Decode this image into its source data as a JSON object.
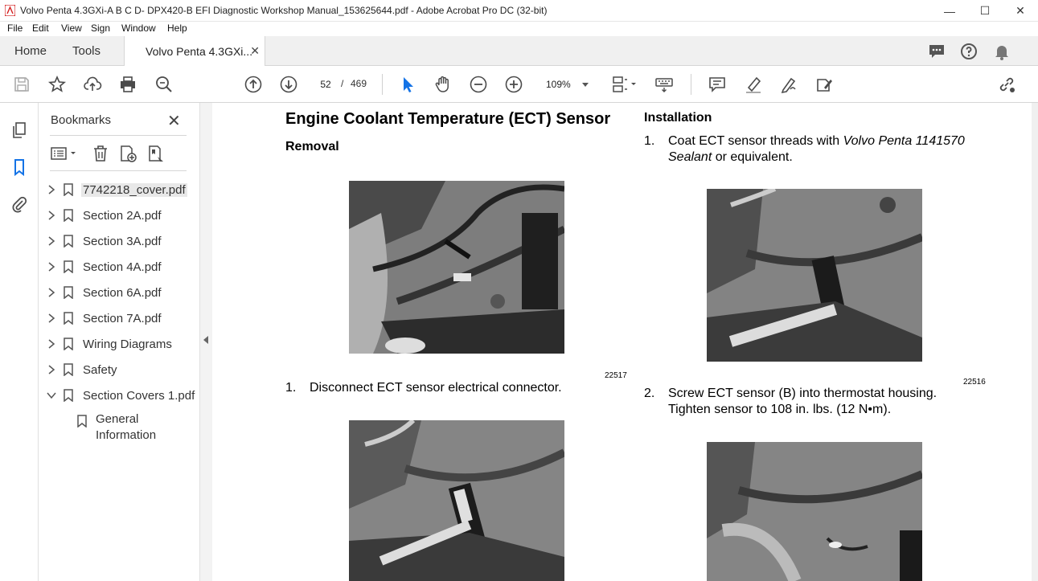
{
  "window": {
    "title": "Volvo Penta 4.3GXi-A B C D- DPX420-B EFI Diagnostic Workshop Manual_153625644.pdf - Adobe Acrobat Pro DC (32-bit)",
    "minimize": "—",
    "maximize": "☐",
    "close": "✕"
  },
  "menu": [
    "File",
    "Edit",
    "View",
    "Sign",
    "Window",
    "Help"
  ],
  "tabs": {
    "home": "Home",
    "tools": "Tools",
    "document": "Volvo Penta 4.3GXi...",
    "close": "✕"
  },
  "toolbar": {
    "page_current": "52",
    "page_separator": "/",
    "page_total": "469",
    "zoom": "109%"
  },
  "bookmarks": {
    "title": "Bookmarks",
    "close": "✕",
    "items": [
      {
        "label": "7742218_cover.pdf",
        "expanded": false,
        "selected": true
      },
      {
        "label": "Section 2A.pdf",
        "expanded": false
      },
      {
        "label": "Section 3A.pdf",
        "expanded": false
      },
      {
        "label": "Section 4A.pdf",
        "expanded": false
      },
      {
        "label": "Section 6A.pdf",
        "expanded": false
      },
      {
        "label": "Section 7A.pdf",
        "expanded": false
      },
      {
        "label": "Wiring Diagrams",
        "expanded": false
      },
      {
        "label": "Safety",
        "expanded": false
      },
      {
        "label": "Section Covers 1.pdf",
        "expanded": true
      }
    ],
    "child": {
      "line1": "General",
      "line2": "Information"
    }
  },
  "document": {
    "heading": "Engine Coolant Temperature (ECT) Sensor",
    "removal": {
      "title": "Removal",
      "fig1_number": "22517",
      "step1_num": "1.",
      "step1_text": "Disconnect ECT sensor electrical connector."
    },
    "installation": {
      "title": "Installation",
      "step1_num": "1.",
      "step1_pre": "Coat ECT sensor threads with ",
      "step1_italic1": "Volvo Penta 1141570",
      "step1_italic2": "Sealant",
      "step1_post": " or equivalent.",
      "fig_number": "22516",
      "step2_num": "2.",
      "step2_line1": "Screw ECT sensor (B) into thermostat housing.",
      "step2_line2": "Tighten sensor to 108 in. lbs. (12 N•m)."
    }
  },
  "colors": {
    "acrobat_red": "#d41f1f",
    "select_blue": "#1473e6",
    "icon_gray": "#4b4b4b"
  }
}
